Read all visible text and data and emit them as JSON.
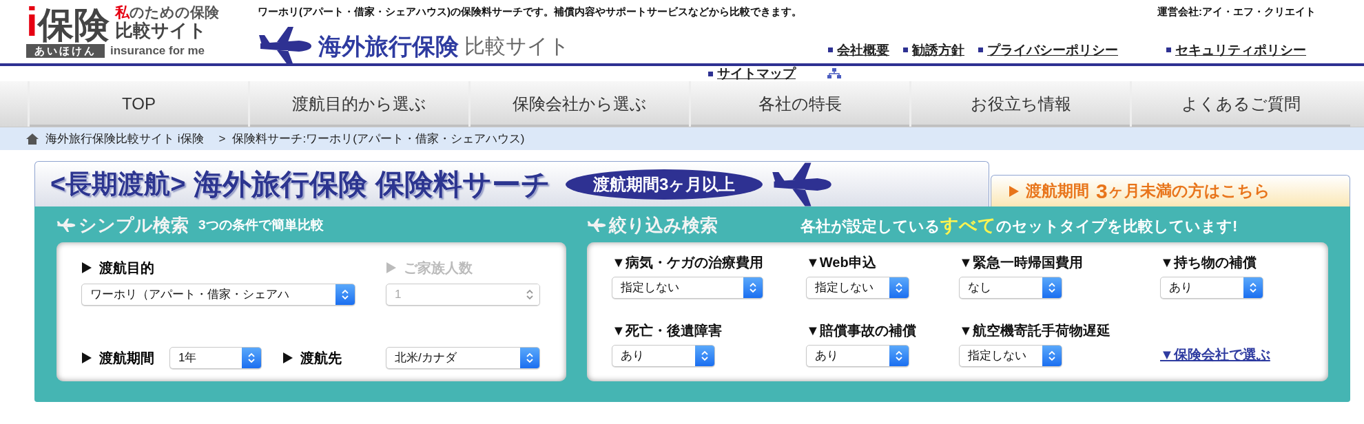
{
  "header": {
    "logo": {
      "mark_i": "i",
      "mark_main": "保険",
      "tagline_highlight": "私",
      "tagline": "のための保険",
      "subtitle": "比較サイト",
      "ribbon": "あいほけん",
      "english": "insurance for me"
    },
    "description": "ワーホリ(アパート・借家・シェアハウス)の保険料サーチです。補償内容やサポートサービスなどから比較できます。",
    "site_title": {
      "main": "海外旅行保険",
      "sub": "比較サイト"
    },
    "operator": "運営会社:アイ・エフ・クリエイト",
    "links": [
      {
        "label": "会社概要",
        "kind": "short"
      },
      {
        "label": "勧誘方針",
        "kind": "short"
      },
      {
        "label": "プライバシーポリシー",
        "kind": "long"
      },
      {
        "label": "セキュリティポリシー",
        "kind": "long"
      },
      {
        "label": "サイトマップ",
        "kind": "sitemap"
      }
    ]
  },
  "nav": [
    "TOP",
    "渡航目的から選ぶ",
    "保険会社から選ぶ",
    "各社の特長",
    "お役立ち情報",
    "よくあるご質問"
  ],
  "breadcrumb": {
    "items": [
      "海外旅行保険比較サイト i保険",
      "保険料サーチ:ワーホリ(アパート・借家・シェアハウス)"
    ],
    "separator": ">"
  },
  "panel": {
    "banner": {
      "bracket_title": "<長期渡航>",
      "title": "海外旅行保険 保険料サーチ",
      "pill": "渡航期間3ヶ月以上"
    },
    "alt_tab": {
      "pre": "渡航期間",
      "num": "3",
      "post": "ヶ月未満の方はこちら"
    },
    "simple": {
      "title": "シンプル検索",
      "subtitle": "3つの条件で簡単比較",
      "fields": [
        {
          "label": "渡航目的",
          "value": "ワーホリ（アパート・借家・シェアハ",
          "disabled": false
        },
        {
          "label": "ご家族人数",
          "value": "1",
          "disabled": true
        },
        {
          "label": "渡航期間",
          "value": "1年",
          "disabled": false
        },
        {
          "label": "渡航先",
          "value": "北米/カナダ",
          "disabled": false
        }
      ]
    },
    "refine": {
      "title": "絞り込み検索",
      "note_pre": "各社が設定している",
      "note_highlight": "すべて",
      "note_post": "のセットタイプを比較しています!",
      "filters": [
        {
          "label": "▼病気・ケガの治療費用",
          "value": "指定しない"
        },
        {
          "label": "▼Web申込",
          "value": "指定しない"
        },
        {
          "label": "▼緊急一時帰国費用",
          "value": "なし"
        },
        {
          "label": "▼持ち物の補償",
          "value": "あり"
        },
        {
          "label": "▼死亡・後遺障害",
          "value": "あり"
        },
        {
          "label": "▼賠償事故の補償",
          "value": "あり"
        },
        {
          "label": "▼航空機寄託手荷物遅延",
          "value": "指定しない"
        }
      ],
      "company_link": "▼保険会社で選ぶ"
    }
  }
}
